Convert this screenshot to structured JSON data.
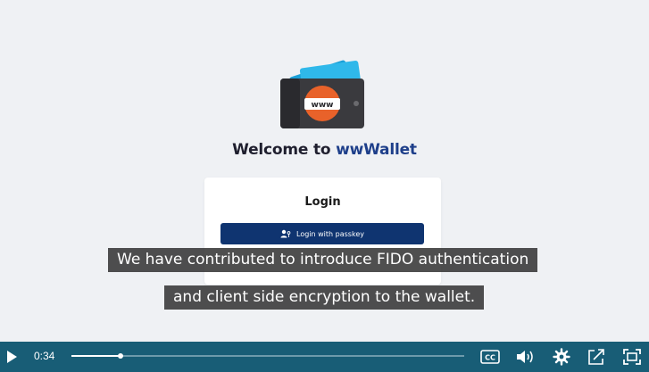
{
  "app": {
    "welcome_prefix": "Welcome to ",
    "brand_name": "wwWallet",
    "logo_text": "www"
  },
  "login": {
    "title": "Login",
    "passkey_label": "Login with passkey"
  },
  "captions": {
    "line1": "We have contributed to introduce FIDO authentication",
    "line2": "and client side encryption to the wallet."
  },
  "player": {
    "current_time": "0:34",
    "progress": 0.125,
    "icons": [
      "play-icon",
      "closed-captions-icon",
      "volume-icon",
      "settings-gear-icon",
      "share-icon",
      "fullscreen-icon"
    ]
  },
  "colors": {
    "brand_blue": "#1e3f8a",
    "button_navy": "#0f3470",
    "player_bar": "#185d76",
    "logo_orange": "#e8622a",
    "card_teal": "#1aa0d8"
  }
}
